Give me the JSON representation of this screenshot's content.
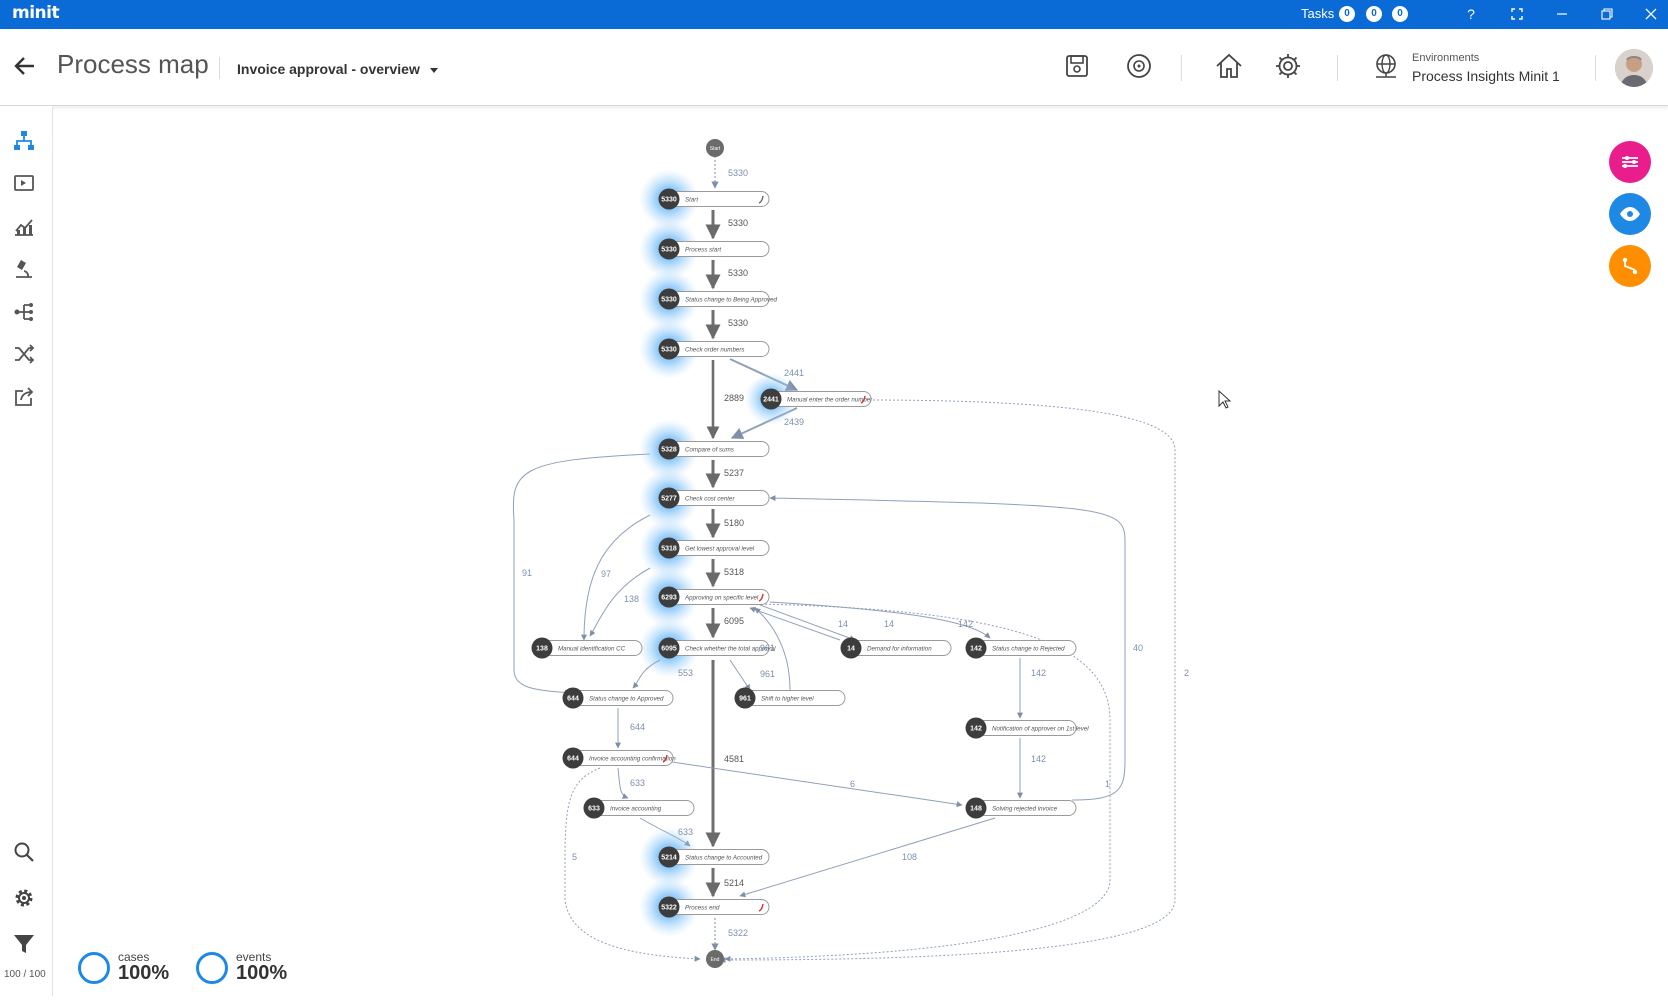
{
  "app": {
    "logo": "minit"
  },
  "titlebar": {
    "tasks_label": "Tasks",
    "task_counts": [
      "0",
      "0",
      "0"
    ],
    "help": "?"
  },
  "header": {
    "title": "Process map",
    "process_view": "Invoice approval - overview",
    "environment_label": "Environments",
    "environment_value": "Process Insights Minit 1"
  },
  "sidebar": {
    "items": [
      "process-map",
      "dashboard",
      "charts",
      "lab",
      "decision-tree",
      "variants",
      "export"
    ],
    "bottom": [
      "search",
      "settings",
      "filter"
    ],
    "filter_count": "100 / 100"
  },
  "stats": {
    "cases_label": "cases",
    "cases_value": "100%",
    "events_label": "events",
    "events_value": "100%"
  },
  "colors": {
    "brand": "#0b6bd6",
    "fab_filter": "#e91e8c",
    "fab_view": "#1e88e5",
    "fab_path": "#ff8f00",
    "node_dark": "#3d3d3d",
    "edge": "#7f8fa8"
  },
  "map": {
    "start_label": "Start",
    "end_label": "End",
    "nodes": [
      {
        "id": "n1",
        "count": "5330",
        "label": "Start"
      },
      {
        "id": "n2",
        "count": "5330",
        "label": "Process start"
      },
      {
        "id": "n3",
        "count": "5330",
        "label": "Status change to Being Approved"
      },
      {
        "id": "n4",
        "count": "5330",
        "label": "Check order numbers"
      },
      {
        "id": "n5",
        "count": "2441",
        "label": "Manual enter the order number"
      },
      {
        "id": "n6",
        "count": "5328",
        "label": "Compare of sums"
      },
      {
        "id": "n7",
        "count": "5277",
        "label": "Check cost center"
      },
      {
        "id": "n8",
        "count": "5318",
        "label": "Get lowest approval level"
      },
      {
        "id": "n9",
        "count": "6293",
        "label": "Approving on specific level"
      },
      {
        "id": "n10",
        "count": "138",
        "label": "Manual identification CC"
      },
      {
        "id": "n11",
        "count": "6095",
        "label": "Check whether the total approval"
      },
      {
        "id": "n12",
        "count": "14",
        "label": "Demand for information"
      },
      {
        "id": "n13",
        "count": "142",
        "label": "Status change to Rejected"
      },
      {
        "id": "n14",
        "count": "644",
        "label": "Status change to Approved"
      },
      {
        "id": "n15",
        "count": "961",
        "label": "Shift to higher level"
      },
      {
        "id": "n16",
        "count": "142",
        "label": "Notification of approver on 1st level"
      },
      {
        "id": "n17",
        "count": "644",
        "label": "Invoice accounting confirmation"
      },
      {
        "id": "n18",
        "count": "633",
        "label": "Invoice accounting"
      },
      {
        "id": "n19",
        "count": "148",
        "label": "Solving rejected invoice"
      },
      {
        "id": "n20",
        "count": "5214",
        "label": "Status change to Accounted"
      },
      {
        "id": "n21",
        "count": "5322",
        "label": "Process end"
      }
    ],
    "edge_labels": [
      {
        "id": "e1",
        "text": "5330"
      },
      {
        "id": "e2",
        "text": "5330"
      },
      {
        "id": "e3",
        "text": "5330"
      },
      {
        "id": "e4",
        "text": "5330"
      },
      {
        "id": "e5",
        "text": "2441"
      },
      {
        "id": "e6",
        "text": "2889"
      },
      {
        "id": "e7",
        "text": "2439"
      },
      {
        "id": "e8",
        "text": "5237"
      },
      {
        "id": "e9",
        "text": "5180"
      },
      {
        "id": "e10",
        "text": "5318"
      },
      {
        "id": "e11",
        "text": "6095"
      },
      {
        "id": "e12",
        "text": "91"
      },
      {
        "id": "e13",
        "text": "97"
      },
      {
        "id": "e14",
        "text": "138"
      },
      {
        "id": "e15",
        "text": "14"
      },
      {
        "id": "e16",
        "text": "14"
      },
      {
        "id": "e17",
        "text": "142"
      },
      {
        "id": "e18",
        "text": "961"
      },
      {
        "id": "e19",
        "text": "961"
      },
      {
        "id": "e20",
        "text": "553"
      },
      {
        "id": "e21",
        "text": "40"
      },
      {
        "id": "e22",
        "text": "2"
      },
      {
        "id": "e23",
        "text": "142"
      },
      {
        "id": "e24",
        "text": "644"
      },
      {
        "id": "e25",
        "text": "4581"
      },
      {
        "id": "e26",
        "text": "142"
      },
      {
        "id": "e27",
        "text": "633"
      },
      {
        "id": "e28",
        "text": "6"
      },
      {
        "id": "e29",
        "text": "1"
      },
      {
        "id": "e30",
        "text": "5"
      },
      {
        "id": "e31",
        "text": "633"
      },
      {
        "id": "e32",
        "text": "108"
      },
      {
        "id": "e33",
        "text": "5214"
      },
      {
        "id": "e34",
        "text": "5322"
      }
    ]
  }
}
